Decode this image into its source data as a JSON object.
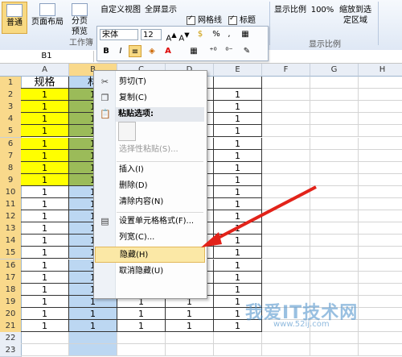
{
  "ribbon": {
    "buttons": [
      {
        "label": "普通"
      },
      {
        "label": "页面布局"
      },
      {
        "label": "分页预览"
      },
      {
        "label": "自定义视图"
      },
      {
        "label": "全屏显示"
      },
      {
        "label": "显示比例"
      },
      {
        "label": "100%"
      },
      {
        "label": "缩放到选定区域"
      }
    ],
    "checkboxes": [
      {
        "label": "网格线"
      },
      {
        "label": "标题"
      }
    ],
    "groups": {
      "workbook": "工作簿",
      "zoom": "显示比例"
    }
  },
  "namebox": "B1",
  "mini_toolbar": {
    "font": "宋体",
    "size": "12",
    "bold": "B",
    "italic": "I",
    "percent": "%",
    "comma": ","
  },
  "columns": [
    "A",
    "B",
    "C",
    "D",
    "E",
    "F",
    "G",
    "H"
  ],
  "rows": [
    "1",
    "2",
    "3",
    "4",
    "5",
    "6",
    "7",
    "8",
    "9",
    "10",
    "11",
    "12",
    "13",
    "14",
    "15",
    "16",
    "17",
    "18",
    "19",
    "20",
    "21",
    "22",
    "23"
  ],
  "cells": {
    "A1": "规格",
    "B1": "材",
    "one": "1"
  },
  "context_menu": {
    "cut": "剪切(T)",
    "copy": "复制(C)",
    "paste_header": "粘贴选项:",
    "paste_special": "选择性粘贴(S)...",
    "insert": "插入(I)",
    "delete": "删除(D)",
    "clear": "清除内容(N)",
    "format": "设置单元格格式(F)...",
    "width": "列宽(C)...",
    "hide": "隐藏(H)",
    "unhide": "取消隐藏(U)"
  },
  "watermark": {
    "main": "我爱IT技术网",
    "sub": "www.52ij.com"
  },
  "colors": {
    "yellow": "#ffff00",
    "green": "#9bbb59",
    "selection": "#bcd7f2",
    "arrow": "#e2231a",
    "highlight": "#f9d98b"
  }
}
